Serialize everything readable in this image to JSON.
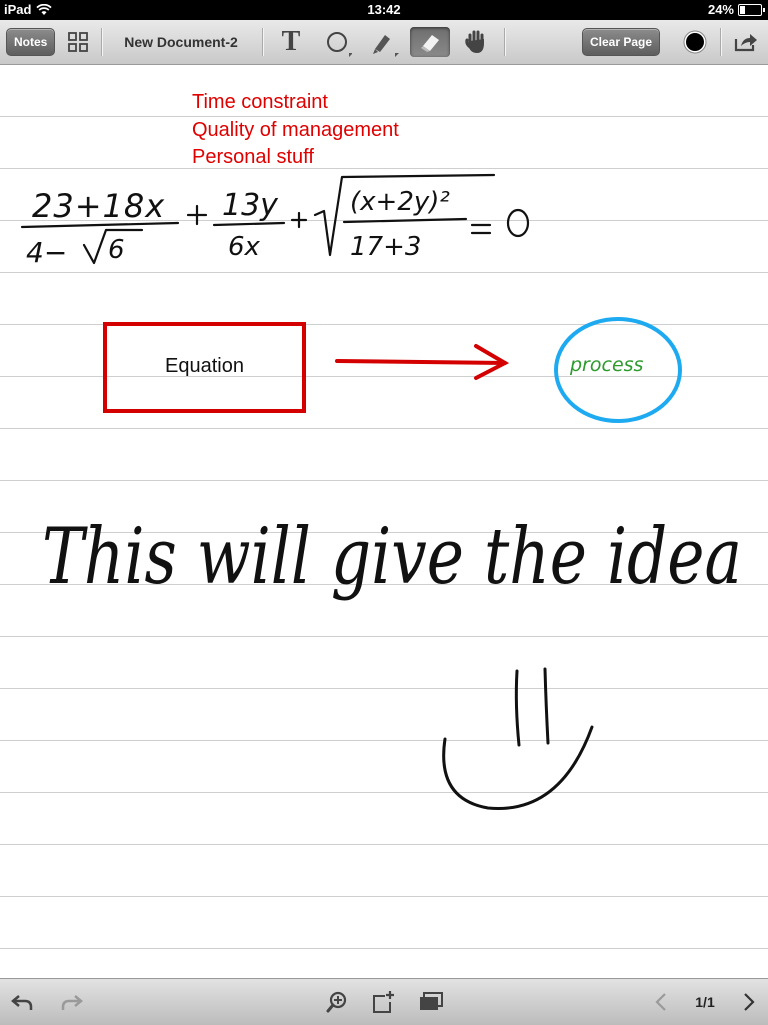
{
  "status_bar": {
    "device": "iPad",
    "time": "13:42",
    "battery": "24%"
  },
  "toolbar": {
    "notes_label": "Notes",
    "doc_title": "New Document-2",
    "text_tool_glyph": "T",
    "clear_page_label": "Clear Page",
    "icons": [
      "grid-icon",
      "text-icon",
      "shape-icon",
      "highlighter-icon",
      "eraser-icon",
      "hand-icon",
      "color-dot-icon",
      "share-icon"
    ],
    "current_color": "#000000"
  },
  "page": {
    "notes": [
      "Time constraint",
      "Quality of management",
      "Personal stuff"
    ],
    "equation_box_label": "Equation",
    "process_label": "process",
    "handwriting": "This will give the idea",
    "equation": "23+18x / (4−∛6) + 13y / 6x + ∛((x+2y)² / (17+3)) = 0",
    "colors": {
      "notes": "#e00000",
      "box": "#d40000",
      "circle": "#1eaaf1",
      "process": "#2c9b2c",
      "ink": "#111111"
    }
  },
  "bottom_bar": {
    "icons": [
      "undo-icon",
      "redo-icon",
      "zoom-icon",
      "add-page-icon",
      "pages-icon",
      "prev-page-icon",
      "next-page-icon"
    ],
    "pager": "1/1"
  }
}
